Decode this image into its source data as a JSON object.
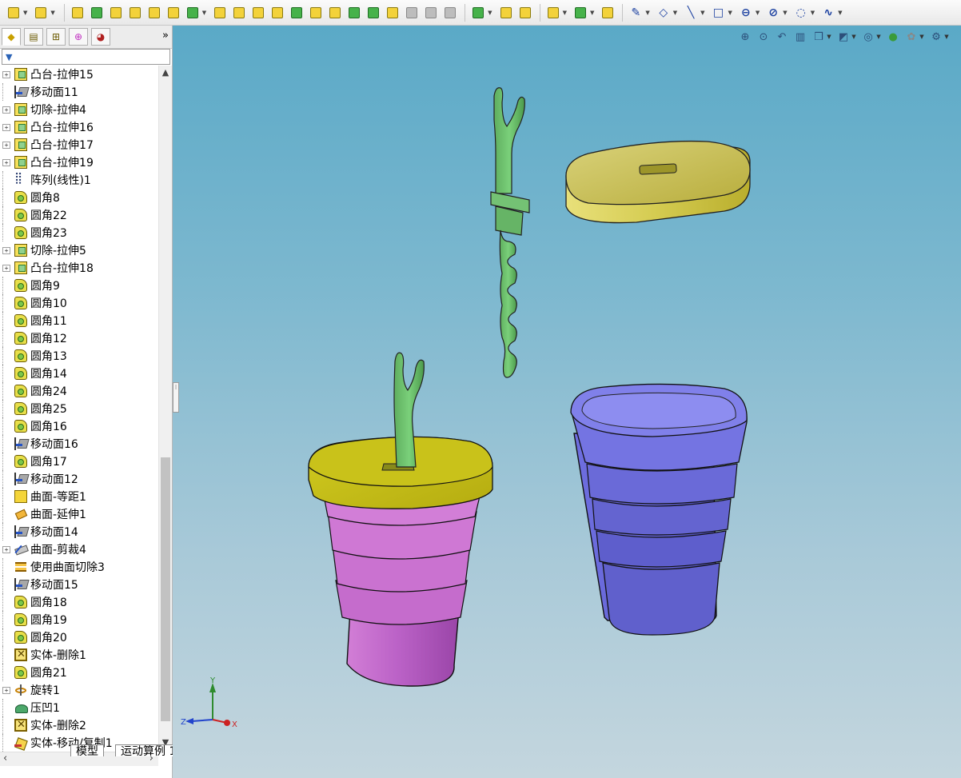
{
  "panel_tabs": [
    "feature-manager",
    "property-manager",
    "configuration-manager",
    "dimxpert-manager",
    "display-manager"
  ],
  "tree_items": [
    {
      "label": "凸台-拉伸15",
      "icon": "extrude-icon",
      "expandable": true
    },
    {
      "label": "移动面11",
      "icon": "move-face-icon",
      "expandable": false
    },
    {
      "label": "切除-拉伸4",
      "icon": "extrude-icon",
      "expandable": true
    },
    {
      "label": "凸台-拉伸16",
      "icon": "extrude-icon",
      "expandable": true
    },
    {
      "label": "凸台-拉伸17",
      "icon": "extrude-icon",
      "expandable": true
    },
    {
      "label": "凸台-拉伸19",
      "icon": "extrude-icon",
      "expandable": true
    },
    {
      "label": "阵列(线性)1",
      "icon": "linear-pattern-icon",
      "expandable": false
    },
    {
      "label": "圆角8",
      "icon": "fillet-icon",
      "expandable": false
    },
    {
      "label": "圆角22",
      "icon": "fillet-icon",
      "expandable": false
    },
    {
      "label": "圆角23",
      "icon": "fillet-icon",
      "expandable": false
    },
    {
      "label": "切除-拉伸5",
      "icon": "extrude-icon",
      "expandable": true
    },
    {
      "label": "凸台-拉伸18",
      "icon": "extrude-icon",
      "expandable": true
    },
    {
      "label": "圆角9",
      "icon": "fillet-icon",
      "expandable": false
    },
    {
      "label": "圆角10",
      "icon": "fillet-icon",
      "expandable": false
    },
    {
      "label": "圆角11",
      "icon": "fillet-icon",
      "expandable": false
    },
    {
      "label": "圆角12",
      "icon": "fillet-icon",
      "expandable": false
    },
    {
      "label": "圆角13",
      "icon": "fillet-icon",
      "expandable": false
    },
    {
      "label": "圆角14",
      "icon": "fillet-icon",
      "expandable": false
    },
    {
      "label": "圆角24",
      "icon": "fillet-icon",
      "expandable": false
    },
    {
      "label": "圆角25",
      "icon": "fillet-icon",
      "expandable": false
    },
    {
      "label": "圆角16",
      "icon": "fillet-icon",
      "expandable": false
    },
    {
      "label": "移动面16",
      "icon": "move-face-icon",
      "expandable": false
    },
    {
      "label": "圆角17",
      "icon": "fillet-icon",
      "expandable": false
    },
    {
      "label": "移动面12",
      "icon": "move-face-icon",
      "expandable": false
    },
    {
      "label": "曲面-等距1",
      "icon": "offset-surface-icon",
      "expandable": false
    },
    {
      "label": "曲面-延伸1",
      "icon": "extend-surface-icon",
      "expandable": false
    },
    {
      "label": "移动面14",
      "icon": "move-face-icon",
      "expandable": false
    },
    {
      "label": "曲面-剪裁4",
      "icon": "trim-surface-icon",
      "expandable": true
    },
    {
      "label": "使用曲面切除3",
      "icon": "surface-cut-icon",
      "expandable": false
    },
    {
      "label": "移动面15",
      "icon": "move-face-icon",
      "expandable": false
    },
    {
      "label": "圆角18",
      "icon": "fillet-icon",
      "expandable": false
    },
    {
      "label": "圆角19",
      "icon": "fillet-icon",
      "expandable": false
    },
    {
      "label": "圆角20",
      "icon": "fillet-icon",
      "expandable": false
    },
    {
      "label": "实体-删除1",
      "icon": "delete-body-icon",
      "expandable": false
    },
    {
      "label": "圆角21",
      "icon": "fillet-icon",
      "expandable": false
    },
    {
      "label": "旋转1",
      "icon": "revolve-icon",
      "expandable": true
    },
    {
      "label": "压凹1",
      "icon": "indent-icon",
      "expandable": false
    },
    {
      "label": "实体-删除2",
      "icon": "delete-body-icon",
      "expandable": false
    },
    {
      "label": "实体-移动/复制1",
      "icon": "move-copy-body-icon",
      "expandable": false
    }
  ],
  "bottom_tabs": [
    "模型",
    "运动算例 1"
  ],
  "triad": {
    "y": "Y",
    "z": "Z",
    "x": "X"
  },
  "colors": {
    "viewport_top": "#5aa9c7",
    "viewport_bottom": "#c4d6de",
    "lid": "#d6cf55",
    "pink_cup": "#c768c9",
    "blue_cup": "#6b6bd4",
    "fork": "#6cc46c"
  }
}
